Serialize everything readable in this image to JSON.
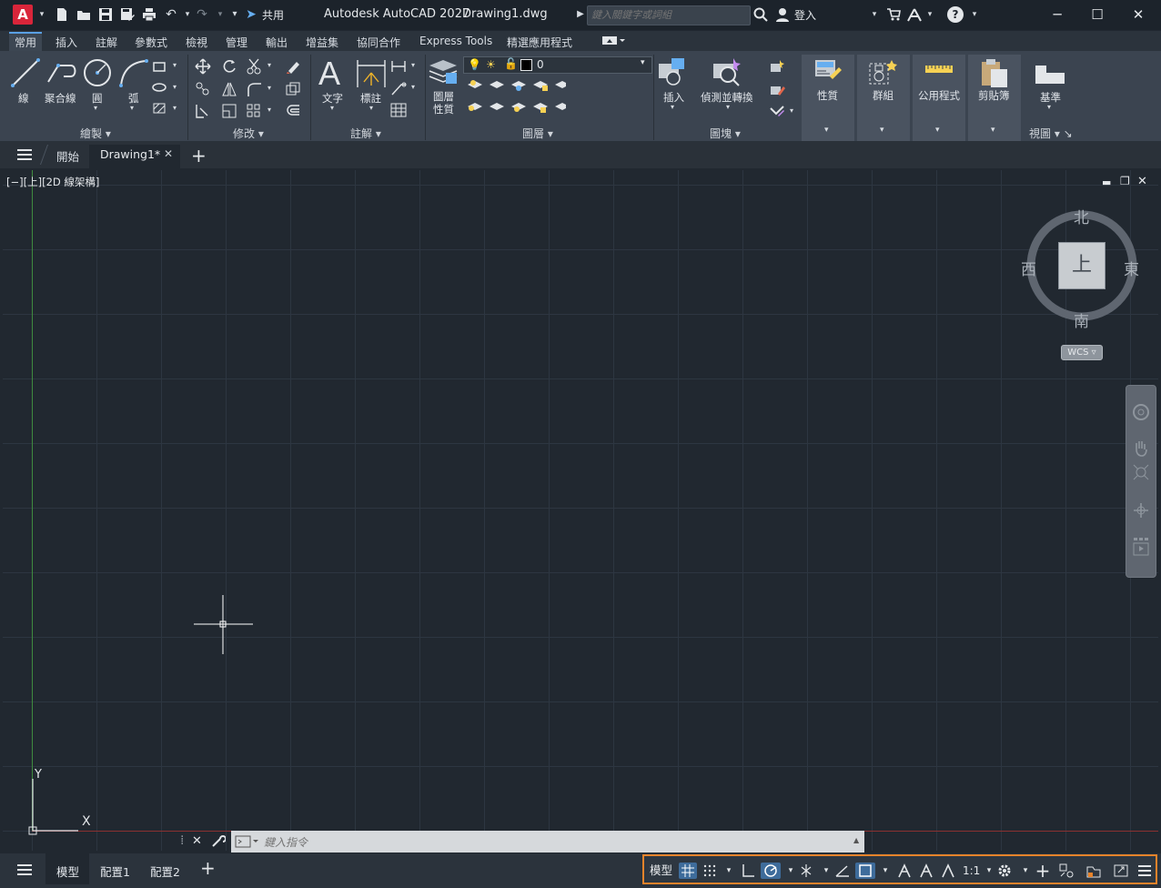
{
  "titlebar": {
    "app_logo": "A",
    "share_label": "共用",
    "app_name": "Autodesk AutoCAD 2027",
    "doc_name": "Drawing1.dwg",
    "search_placeholder": "鍵入關鍵字或詞組",
    "signin_label": "登入",
    "help_label": "?"
  },
  "ribbon_tabs": [
    "常用",
    "插入",
    "註解",
    "參數式",
    "檢視",
    "管理",
    "輸出",
    "增益集",
    "協同合作",
    "Express Tools",
    "精選應用程式"
  ],
  "ribbon": {
    "draw": {
      "panel": "繪製",
      "line": "線",
      "polyline": "聚合線",
      "circle": "圓",
      "arc": "弧"
    },
    "modify": {
      "panel": "修改"
    },
    "annotation": {
      "panel": "註解",
      "text": "文字",
      "dimension": "標註"
    },
    "layers": {
      "panel": "圖層",
      "layer_props": "圖層\n性質",
      "current_layer": "0"
    },
    "block": {
      "panel": "圖塊",
      "insert": "插入",
      "detect_convert": "偵測並轉換"
    },
    "properties": "性質",
    "groups": "群組",
    "utilities": "公用程式",
    "clipboard": "剪貼簿",
    "view": {
      "panel": "視圖",
      "base": "基準"
    }
  },
  "doc_tabs": {
    "start": "開始",
    "current": "Drawing1*"
  },
  "viewport": {
    "label": "[−][上][2D 線架構]"
  },
  "viewcube": {
    "north": "北",
    "south": "南",
    "east": "東",
    "west": "西",
    "face": "上",
    "wcs": "WCS"
  },
  "ucs": {
    "x": "X",
    "y": "Y"
  },
  "command": {
    "placeholder": "鍵入指令"
  },
  "layout_tabs": [
    "模型",
    "配置1",
    "配置2"
  ],
  "status": {
    "model": "模型",
    "scale": "1:1"
  },
  "colors": {
    "accent": "#5aa0e4",
    "statusbar_outline": "#e8832a",
    "ucs_y_axis": "#3f8a3f",
    "ucs_x_axis": "#8a3030"
  }
}
